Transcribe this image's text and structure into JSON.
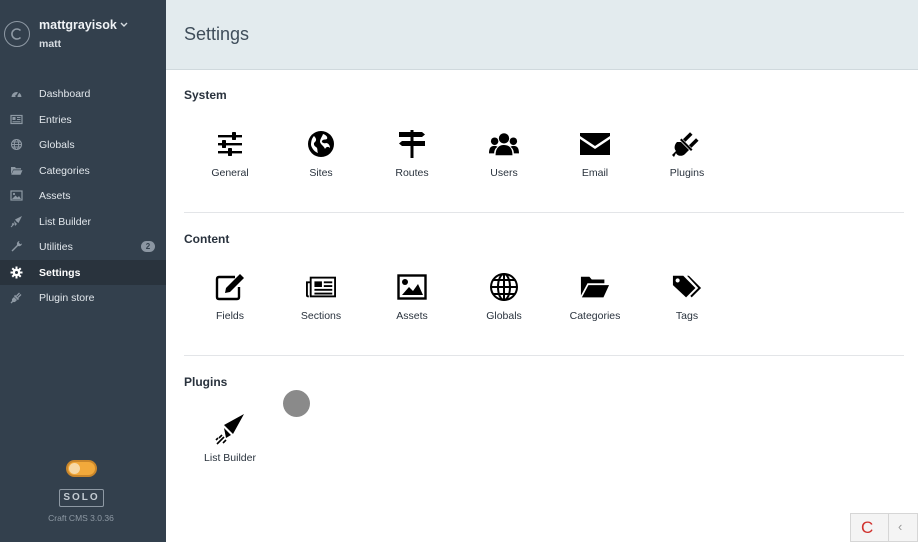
{
  "user": {
    "name": "mattgrayisok",
    "sub": "matt"
  },
  "nav": [
    {
      "label": "Dashboard",
      "icon": "dashboard-icon"
    },
    {
      "label": "Entries",
      "icon": "entries-icon"
    },
    {
      "label": "Globals",
      "icon": "globe-icon"
    },
    {
      "label": "Categories",
      "icon": "folder-icon"
    },
    {
      "label": "Assets",
      "icon": "image-icon"
    },
    {
      "label": "List Builder",
      "icon": "paper-plane-icon"
    },
    {
      "label": "Utilities",
      "icon": "wrench-icon",
      "badge": "2"
    },
    {
      "label": "Settings",
      "icon": "gear-icon",
      "active": true
    },
    {
      "label": "Plugin store",
      "icon": "plug-icon"
    }
  ],
  "edition": "SOLO",
  "version": "Craft CMS 3.0.36",
  "header": {
    "title": "Settings"
  },
  "sections": [
    {
      "title": "System",
      "tiles": [
        {
          "label": "General",
          "icon": "sliders-icon"
        },
        {
          "label": "Sites",
          "icon": "globe-icon"
        },
        {
          "label": "Routes",
          "icon": "signpost-icon"
        },
        {
          "label": "Users",
          "icon": "users-icon"
        },
        {
          "label": "Email",
          "icon": "envelope-icon"
        },
        {
          "label": "Plugins",
          "icon": "plug-icon"
        }
      ]
    },
    {
      "title": "Content",
      "tiles": [
        {
          "label": "Fields",
          "icon": "edit-icon"
        },
        {
          "label": "Sections",
          "icon": "newspaper-icon"
        },
        {
          "label": "Assets",
          "icon": "image-icon"
        },
        {
          "label": "Globals",
          "icon": "globe-wire-icon"
        },
        {
          "label": "Categories",
          "icon": "folder-open-icon"
        },
        {
          "label": "Tags",
          "icon": "tags-icon"
        }
      ]
    },
    {
      "title": "Plugins",
      "tiles": [
        {
          "label": "List Builder",
          "icon": "paper-plane-icon"
        }
      ]
    }
  ],
  "devbar": {
    "logo": "C",
    "arrow": "‹"
  }
}
